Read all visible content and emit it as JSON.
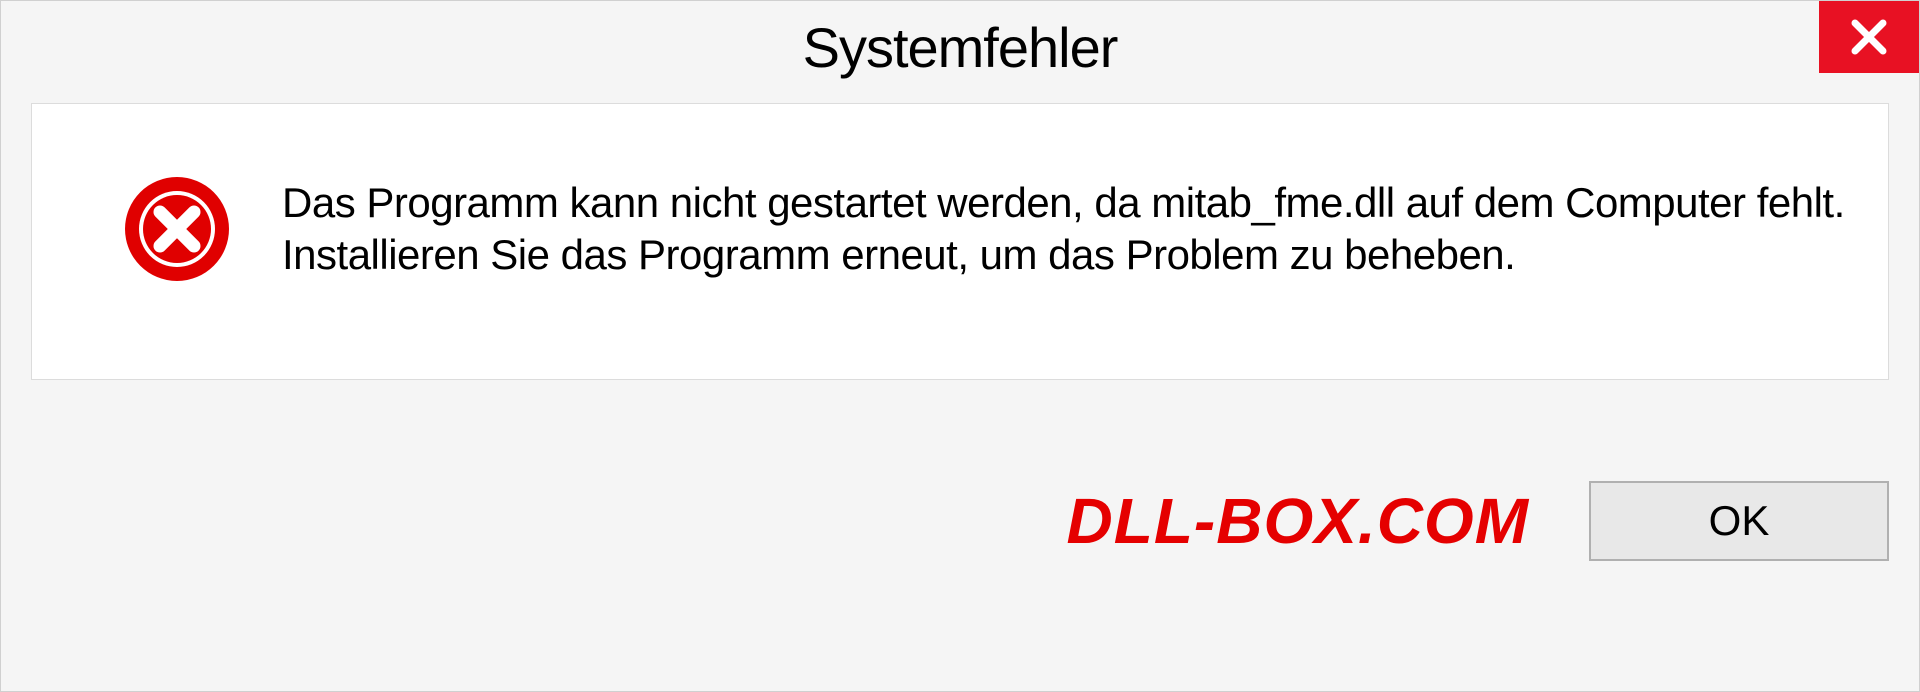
{
  "dialog": {
    "title": "Systemfehler",
    "message": "Das Programm kann nicht gestartet werden, da mitab_fme.dll auf dem Computer fehlt. Installieren Sie das Programm erneut, um das Problem zu beheben.",
    "ok_label": "OK"
  },
  "watermark": "DLL-BOX.COM"
}
